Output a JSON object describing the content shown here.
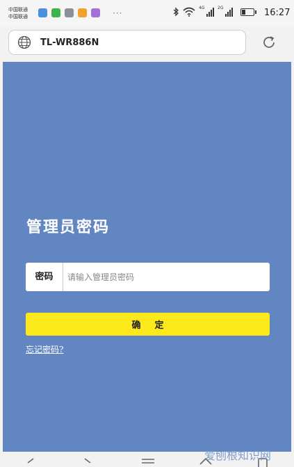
{
  "status_bar": {
    "carrier_line1": "中国联通",
    "carrier_line2": "中国联通",
    "dots": "···",
    "net1": "4G",
    "net2": "2G",
    "time": "16:27"
  },
  "browser": {
    "url": "TL-WR886N"
  },
  "login": {
    "title": "管理员密码",
    "password_label": "密码",
    "password_placeholder": "请输入管理员密码",
    "password_value": "",
    "confirm_label": "确定",
    "forgot_link": "忘记密码?"
  },
  "watermark": {
    "text": "爱刨根知识网"
  },
  "colors": {
    "page_bg": "#6286c2",
    "confirm_button": "#fde81b"
  }
}
